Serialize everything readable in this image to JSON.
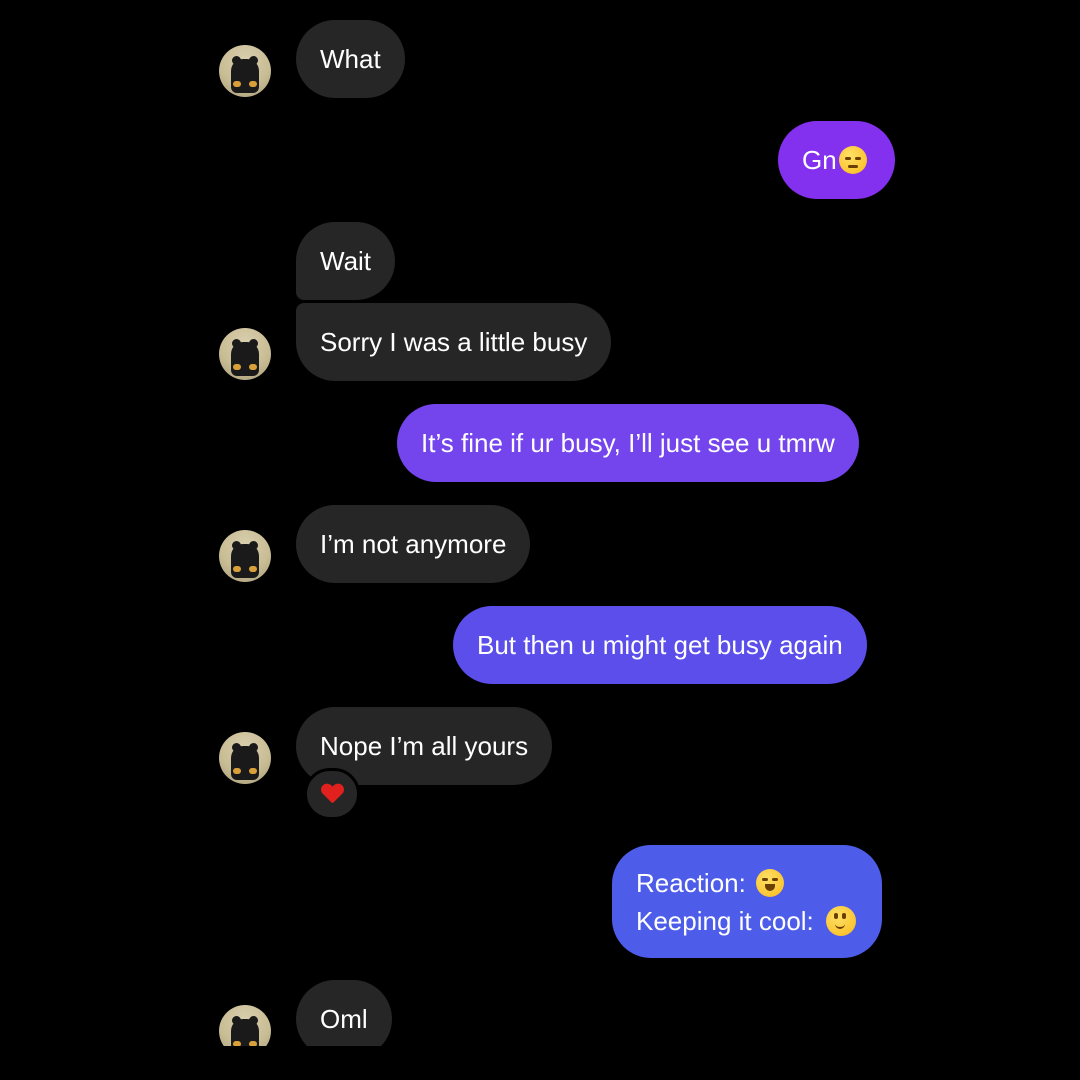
{
  "messages": [
    {
      "side": "in",
      "text": "What"
    },
    {
      "side": "out",
      "text": "Gn",
      "emoji": "pensive-face"
    },
    {
      "side": "in",
      "text": "Wait"
    },
    {
      "side": "in",
      "text": "Sorry I was a little busy"
    },
    {
      "side": "out",
      "text": "It’s fine if ur busy, I’ll just see u tmrw"
    },
    {
      "side": "in",
      "text": "I’m not anymore"
    },
    {
      "side": "out",
      "text": "But then u might get busy again"
    },
    {
      "side": "in",
      "text": "Nope I’m all yours",
      "reaction": "red-heart"
    },
    {
      "side": "out",
      "line1": "Reaction:",
      "line1_emoji": "grinning-squinting-face",
      "line2": "Keeping it cool:",
      "line2_emoji": "slightly-smiling-face"
    },
    {
      "side": "in",
      "text": "Oml"
    }
  ],
  "colors": {
    "background": "#000000",
    "incoming_bubble": "#262626",
    "outgoing_gradient_top": "#8a2cf0",
    "outgoing_gradient_bottom": "#3b66e8"
  }
}
